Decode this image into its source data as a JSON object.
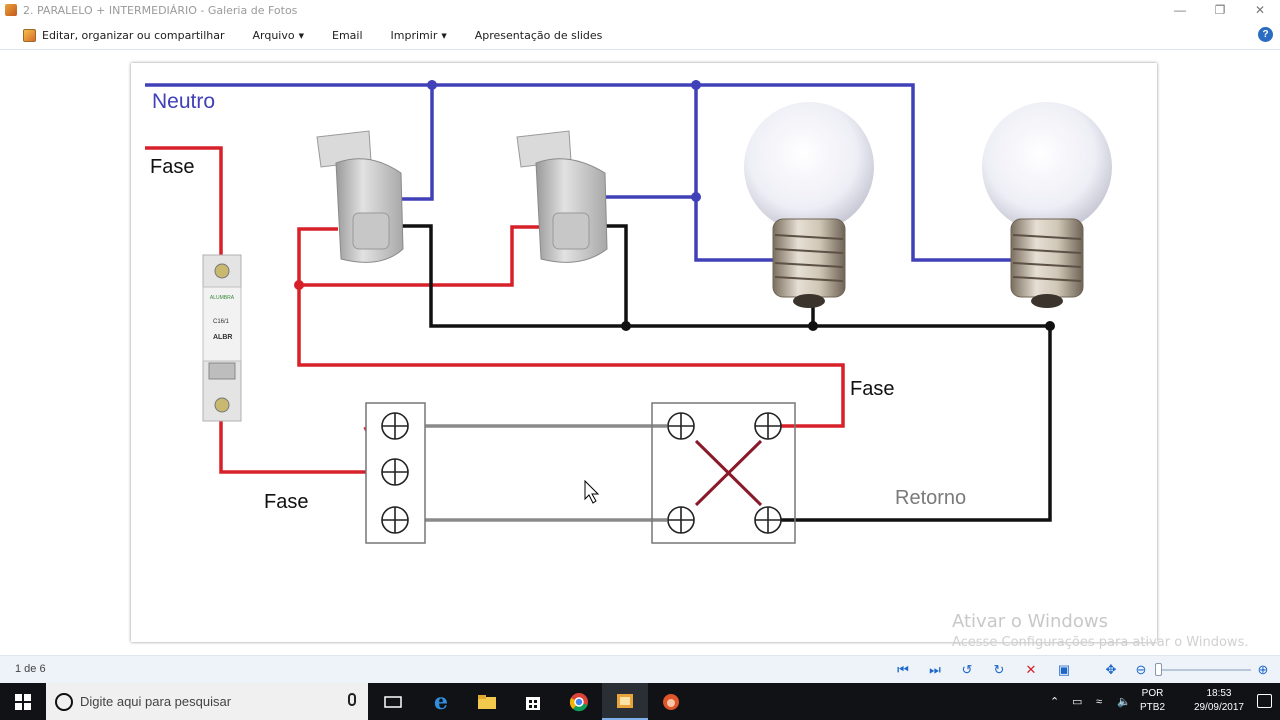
{
  "window": {
    "title": "2. PARALELO + INTERMEDIÁRIO - Galeria de Fotos",
    "minimize_icon": "minimize-icon",
    "restore_icon": "restore-icon",
    "close_icon": "close-icon"
  },
  "menu": {
    "edit_label": "Editar, organizar ou compartilhar",
    "file_label": "Arquivo",
    "email_label": "Email",
    "print_label": "Imprimir",
    "slideshow_label": "Apresentação de slides",
    "help_label": "?"
  },
  "diagram": {
    "neutral_label": "Neutro",
    "phase_label_1": "Fase",
    "phase_label_2": "Fase",
    "phase_label_3": "Fase",
    "return_label": "Retorno",
    "breaker_brand": "ALUMBRA",
    "breaker_model": "C16/1",
    "breaker_series": "ALBR",
    "colors": {
      "neutral": "#4040b8",
      "phase": "#d8202a",
      "return": "#111111",
      "switch_wire": "#8a8a8a",
      "cross_wire": "#8a1a2a"
    }
  },
  "watermark": {
    "line1": "Ativar o Windows",
    "line2": "Acesse Configurações para ativar o Windows."
  },
  "status": {
    "counter": "1 de 6"
  },
  "taskbar": {
    "search_placeholder": "Digite aqui para pesquisar",
    "lang_top": "POR",
    "lang_bottom": "PTB2",
    "time": "18:53",
    "date": "29/09/2017"
  }
}
